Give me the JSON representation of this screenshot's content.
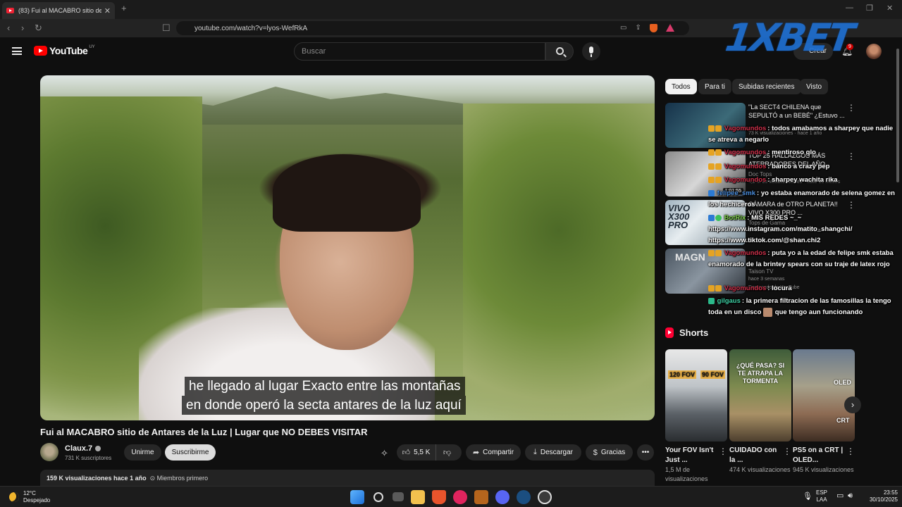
{
  "browser": {
    "tab_title": "(83) Fui al MACABRO sitio de An",
    "url": "youtube.com/watch?v=lyos-WefRkA"
  },
  "youtube": {
    "logo_text": "YouTube",
    "country_code": "UY",
    "search_placeholder": "Buscar",
    "create_label": "Crear",
    "notif_count": "9",
    "overlay_brand": "1XBET"
  },
  "player": {
    "captions": [
      "he llegado al lugar Exacto entre las montañas",
      "en donde operó la secta antares de la luz aquí"
    ]
  },
  "video": {
    "title": "Fui al MACABRO sitio de Antares de la Luz | Lugar que NO DEBES VISITAR",
    "channel_name": "Claux.7",
    "subscribers": "731 K suscriptores",
    "join_label": "Unirme",
    "subscribe_label": "Suscribirme",
    "likes": "5,5 K",
    "share_label": "Compartir",
    "download_label": "Descargar",
    "thanks_label": "Gracias",
    "views_time": "159 K visualizaciones  hace 1 año",
    "members_tag": "Miembros primero"
  },
  "chips": [
    "Todos",
    "Para ti",
    "Subidas recientes",
    "Visto"
  ],
  "recommendations": [
    {
      "title": "\"La SECT4 CHILENA que SEPULTÓ a un BEBÉ\" ¿Estuvo ...",
      "channel": "",
      "meta": "73 K visualizaciones · hace 1 año",
      "duration": ""
    },
    {
      "title": "TOP 25 HALLAZGOS MÁS ATERRADORES DEL AÑO",
      "channel": "Doc Tops",
      "meta": "4,2 M de visualizaciones · hace 10 meses",
      "duration": "1:01:55"
    },
    {
      "title": "CÁMARA de OTRO PLANETA!! VIVO X300 PRO ...",
      "channel": "Tops de Gama",
      "meta": "14 K visualizaciones · hace 1 día",
      "duration": ""
    },
    {
      "title": "",
      "channel": "Taison TV",
      "meta": "hace 3 semanas",
      "duration": ""
    }
  ],
  "rec_extra": "Destacado de YouTube",
  "chat": [
    {
      "user": "Vagomundos",
      "text": ": todos amabamos a sharpey que nadie se atreva a negarlo",
      "color": "#d0314b"
    },
    {
      "user": "Vagomundos",
      "text": ": mentiroso qlo",
      "color": "#d0314b"
    },
    {
      "user": "Vagomundos",
      "text": ": banco a crazy pep",
      "color": "#d0314b"
    },
    {
      "user": "Vagomundos",
      "text": ": sharpey wachita rika",
      "color": "#d0314b"
    },
    {
      "user": "felipee_smk",
      "text": ": yo estaba enamorado de selena gomez en los hechiceros",
      "color": "#4b8fe0"
    },
    {
      "user": "BotRix",
      "text": ": MIS REDES ~_~ https://www.instagram.com/matito_shangchi/ https://www.tiktok.com/@shan.chi2",
      "color": "#7fd04b"
    },
    {
      "user": "Vagomundos",
      "text": ": puta yo a la edad de felipe smk estaba enamorado de la brintey spears con su traje de latex rojo",
      "color": "#d0314b"
    },
    {
      "user": "Vagomundos",
      "text": ": locura",
      "color": "#d0314b"
    },
    {
      "user": "gilgaus",
      "text": ": la primera filtracion de las famosillas la tengo toda en un disco",
      "color": "#3ed0a4"
    },
    {
      "user": "",
      "text": "que tengo aun funcionando",
      "color": "#ffffff"
    }
  ],
  "shorts": {
    "heading": "Shorts",
    "items": [
      {
        "title": "Your FOV Isn't Just ...",
        "views": "1,5 M de visualizaciones",
        "labels": [
          "120 FOV",
          "90 FOV"
        ]
      },
      {
        "title": "CUIDADO con la ...",
        "views": "474 K visualizaciones",
        "labels": [
          "¿QUÉ PASA? SI TE ATRAPA LA TORMENTA"
        ]
      },
      {
        "title": "PS5 on a CRT | OLED...",
        "views": "945 K visualizaciones",
        "labels": [
          "OLED",
          "CRT"
        ]
      }
    ]
  },
  "taskbar": {
    "temperature": "12°C",
    "weather": "Despejado",
    "lang1": "ESP",
    "lang2": "LAA",
    "time": "23:55",
    "date": "30/10/2025"
  }
}
